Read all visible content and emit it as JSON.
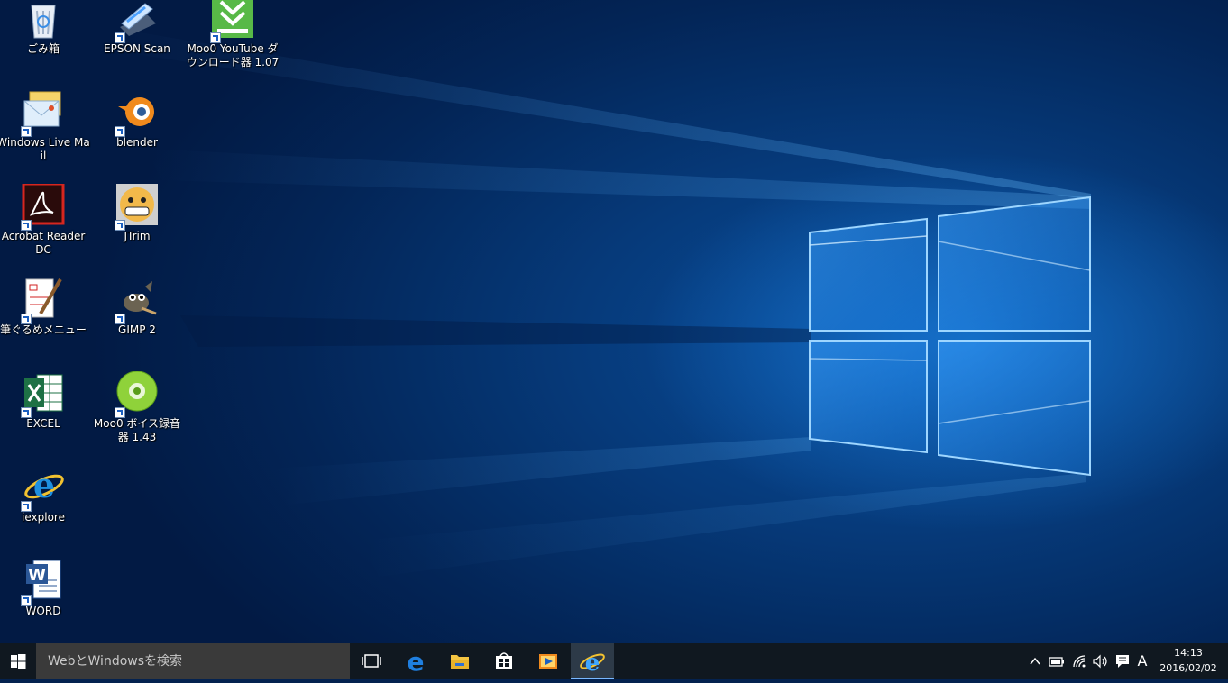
{
  "desktop_icons": [
    {
      "label": "ごみ箱"
    },
    {
      "label": "EPSON Scan"
    },
    {
      "label": "Moo0 YouTube ダウンロード器 1.07"
    },
    {
      "label": "Windows Live Mail"
    },
    {
      "label": "blender"
    },
    {
      "label": "Acrobat Reader DC"
    },
    {
      "label": "JTrim"
    },
    {
      "label": "筆ぐるめメニュー"
    },
    {
      "label": "GIMP 2"
    },
    {
      "label": "EXCEL"
    },
    {
      "label": "Moo0 ボイス録音器 1.43"
    },
    {
      "label": "iexplore"
    },
    {
      "label": "WORD"
    }
  ],
  "taskbar": {
    "search_placeholder": "WebとWindowsを検索",
    "pinned": [
      {
        "icon": "task-view-icon"
      },
      {
        "icon": "edge-icon"
      },
      {
        "icon": "file-explorer-icon"
      },
      {
        "icon": "store-icon"
      },
      {
        "icon": "media-player-icon"
      },
      {
        "icon": "internet-explorer-icon",
        "active": true
      }
    ],
    "tray": {
      "ime_mode": "A",
      "time": "14:13",
      "date": "2016/02/02"
    }
  },
  "colors": {
    "accent": "#1e8cf0",
    "taskbar_bg": "#101820",
    "search_bg": "#3a3a3a"
  }
}
